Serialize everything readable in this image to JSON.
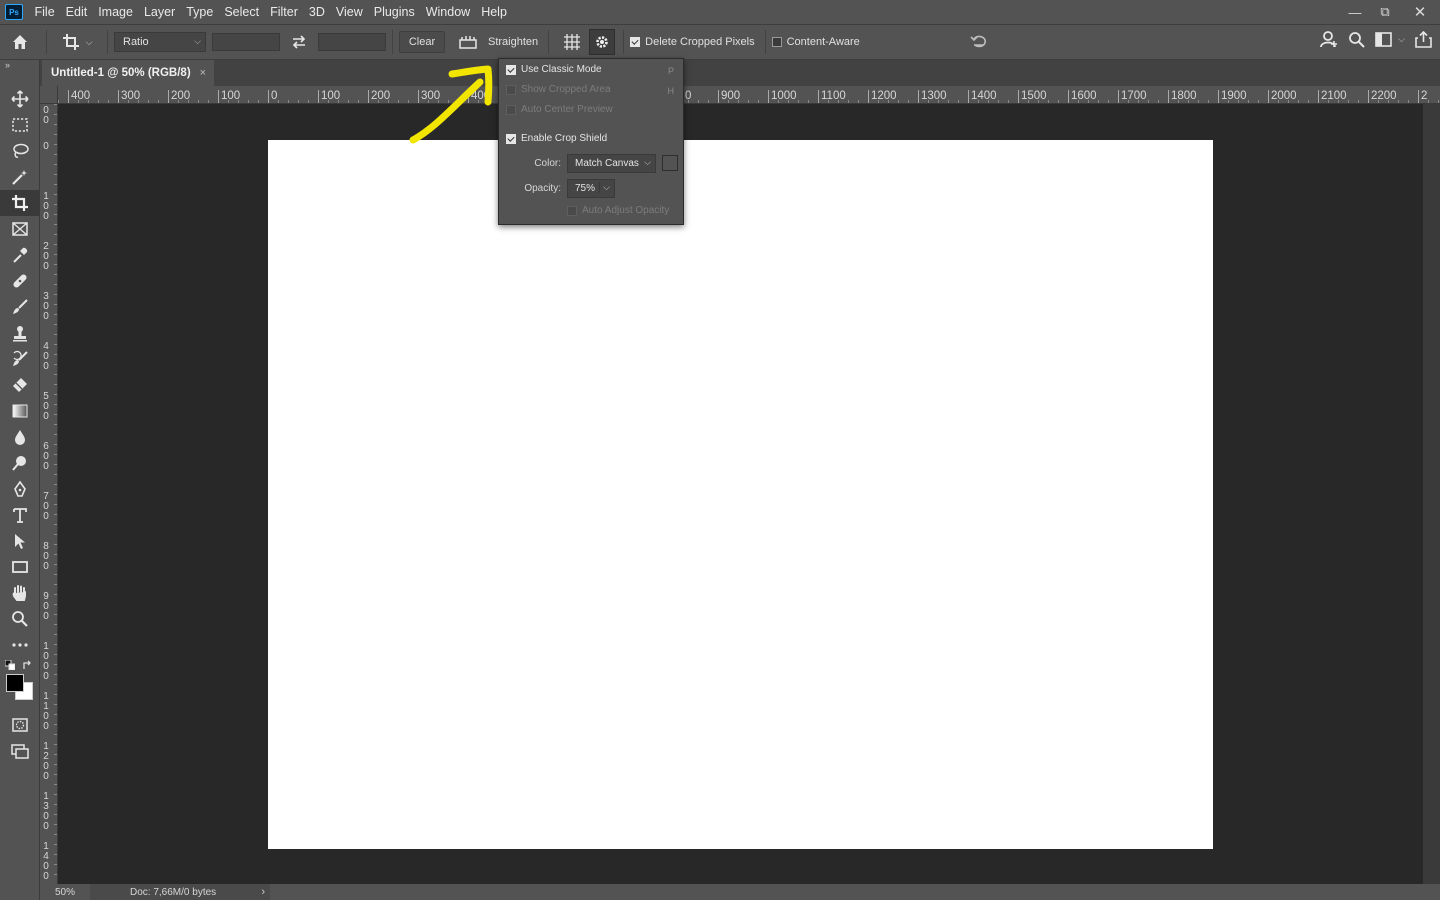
{
  "app": {
    "logo_text": "Ps"
  },
  "menubar": {
    "items": [
      "File",
      "Edit",
      "Image",
      "Layer",
      "Type",
      "Select",
      "Filter",
      "3D",
      "View",
      "Plugins",
      "Window",
      "Help"
    ],
    "window_controls": {
      "minimize": "—",
      "restore": "⧉",
      "close": "✕"
    }
  },
  "options_bar": {
    "ratio_label": "Ratio",
    "width_value": "",
    "height_value": "",
    "clear_label": "Clear",
    "straighten_label": "Straighten",
    "delete_cropped_label": "Delete Cropped Pixels",
    "delete_cropped_checked": true,
    "content_aware_label": "Content-Aware",
    "content_aware_checked": false
  },
  "document": {
    "tab_title": "Untitled-1 @ 50% (RGB/8)",
    "close_glyph": "×"
  },
  "rulers": {
    "horizontal": [
      "400",
      "300",
      "200",
      "100",
      "0",
      "100",
      "200",
      "300",
      "400",
      "",
      "",
      "",
      "0",
      "900",
      "1000",
      "1100",
      "1200",
      "1300",
      "1400",
      "1500",
      "1600",
      "1700",
      "1800",
      "1900",
      "2000",
      "2100",
      "2200",
      "2"
    ],
    "vertical": [
      "0\n0",
      "0",
      "1\n0\n0",
      "2\n0\n0",
      "3\n0\n0",
      "4\n0\n0",
      "5\n0\n0",
      "6\n0\n0",
      "7\n0\n0",
      "8\n0\n0",
      "9\n0\n0",
      "1\n0\n0\n0",
      "1\n1\n0\n0",
      "1\n2\n0\n0",
      "1\n3\n0\n0",
      "1\n4\n0\n0"
    ]
  },
  "crop_options_panel": {
    "use_classic_mode": {
      "label": "Use Classic Mode",
      "shortcut": "P",
      "checked": true
    },
    "show_cropped_area": {
      "label": "Show Cropped Area",
      "shortcut": "H",
      "checked": false,
      "disabled": true
    },
    "auto_center_preview": {
      "label": "Auto Center Preview",
      "checked": false,
      "disabled": true
    },
    "enable_crop_shield": {
      "label": "Enable Crop Shield",
      "checked": true
    },
    "color_label": "Color:",
    "color_value": "Match Canvas",
    "opacity_label": "Opacity:",
    "opacity_value": "75%",
    "auto_adjust_opacity": {
      "label": "Auto Adjust Opacity",
      "checked": false,
      "disabled": true
    }
  },
  "status_bar": {
    "zoom": "50%",
    "doc_info": "Doc: 7,66M/0 bytes",
    "arrow": "›"
  },
  "colors": {
    "ui_bg": "#535353",
    "canvas_bg": "#282828",
    "annotation_yellow": "#f2e600"
  }
}
